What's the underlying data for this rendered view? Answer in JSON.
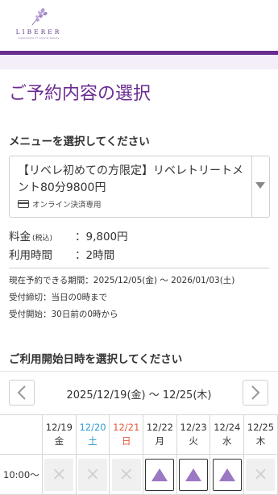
{
  "header": {
    "logo_name": "LIBERER",
    "logo_sub": "supplement of original beauty"
  },
  "colors": {
    "brand_purple": "#6a2c91",
    "lavender": "#f3eef8",
    "triangle": "#9a78c4",
    "saturday": "#2f9ad6",
    "sunday": "#e2583e"
  },
  "page_title": "ご予約内容の選択",
  "menu_section": {
    "label": "メニューを選択してください",
    "selected": "【リベレ初めての方限定】リベレトリートメント80分9800円",
    "payment_note": "オンライン決済専用",
    "payment_icon": "credit-card-icon",
    "dropdown_icon": "caret-down-icon"
  },
  "price": {
    "label": "料金",
    "tax": "(税込)",
    "value": "：9,800円"
  },
  "duration": {
    "label": "利用時間",
    "value": "：2時間"
  },
  "notes": [
    "現在予約できる期間：2025/12/05(金) 〜 2026/01/03(土)",
    "受付締切：当日の0時まで",
    "受付開始：30日前の0時から"
  ],
  "datetime_section": {
    "label": "ご利用開始日時を選択してください"
  },
  "calendar": {
    "range": "2025/12/19(金) 〜 12/25(木)",
    "prev_icon": "chevron-left-icon",
    "next_icon": "chevron-right-icon",
    "days": [
      {
        "date": "12/19",
        "dow": "金",
        "type": "weekday"
      },
      {
        "date": "12/20",
        "dow": "土",
        "type": "sat"
      },
      {
        "date": "12/21",
        "dow": "日",
        "type": "sun"
      },
      {
        "date": "12/22",
        "dow": "月",
        "type": "weekday"
      },
      {
        "date": "12/23",
        "dow": "火",
        "type": "weekday"
      },
      {
        "date": "12/24",
        "dow": "水",
        "type": "weekday"
      },
      {
        "date": "12/25",
        "dow": "木",
        "type": "weekday"
      }
    ],
    "rows": [
      {
        "time": "10:00〜",
        "slots": [
          "×",
          "×",
          "×",
          "△",
          "△",
          "△",
          "×"
        ]
      }
    ]
  }
}
